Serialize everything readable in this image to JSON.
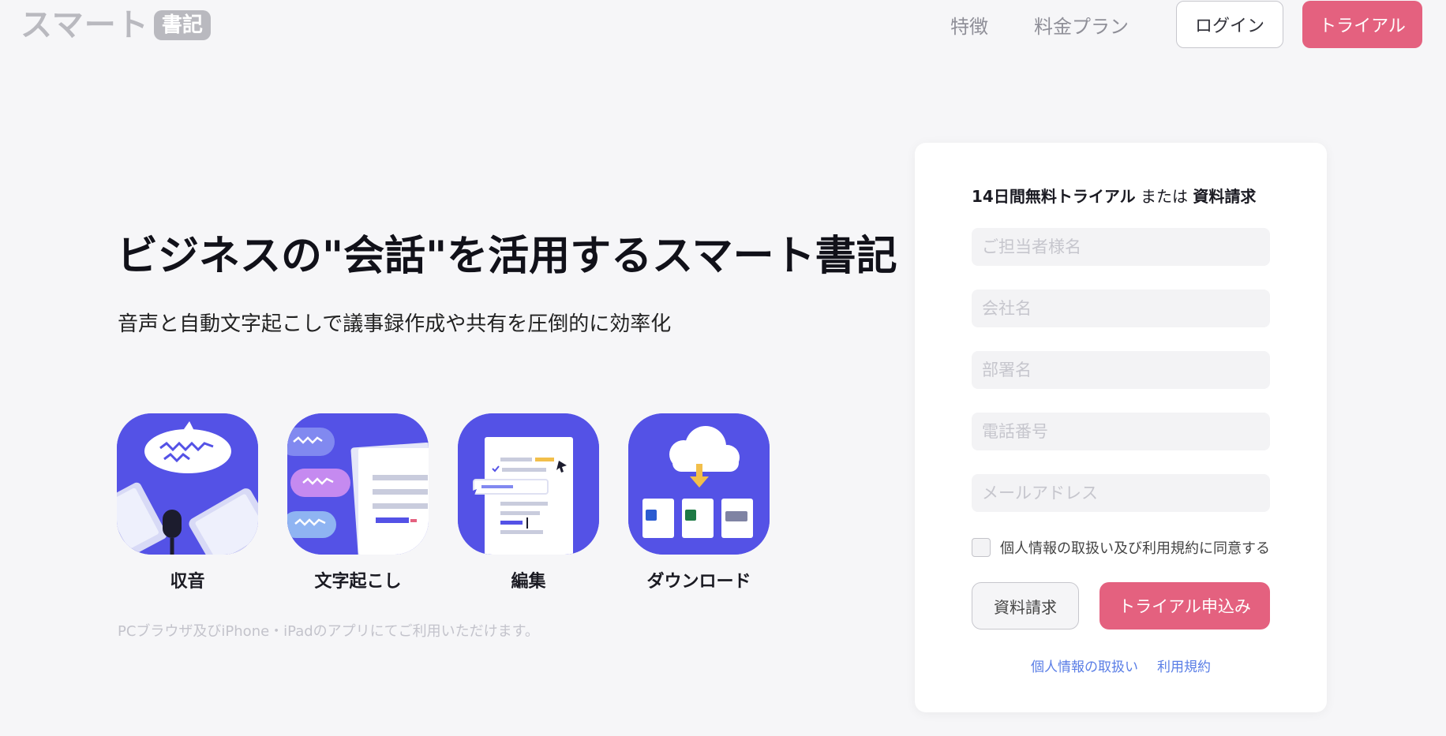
{
  "header": {
    "logo_text": "スマート",
    "logo_badge": "書記",
    "nav": [
      "特徴",
      "料金プラン"
    ],
    "login_label": "ログイン",
    "trial_label": "トライアル"
  },
  "hero": {
    "title": "ビジネスの\"会話\"を活用するスマート書記",
    "subtitle": "音声と自動文字起こしで議事録作成や共有を圧倒的に効率化"
  },
  "features": [
    {
      "label": "収音",
      "icon": "microphone-icon"
    },
    {
      "label": "文字起こし",
      "icon": "transcription-icon"
    },
    {
      "label": "編集",
      "icon": "edit-document-icon"
    },
    {
      "label": "ダウンロード",
      "icon": "cloud-download-icon"
    }
  ],
  "footnote": "PCブラウザ及びiPhone・iPadのアプリにてご利用いただけます。",
  "form": {
    "title_trial": "14日間無料トライアル",
    "title_or": " または ",
    "title_doc": "資料請求",
    "fields": {
      "name": {
        "placeholder": "ご担当者様名",
        "value": ""
      },
      "company": {
        "placeholder": "会社名",
        "value": ""
      },
      "department": {
        "placeholder": "部署名",
        "value": ""
      },
      "phone": {
        "placeholder": "電話番号",
        "value": ""
      },
      "email": {
        "placeholder": "メールアドレス",
        "value": ""
      }
    },
    "agree_label": "個人情報の取扱い及び利用規約に同意する",
    "doc_button": "資料請求",
    "apply_button": "トライアル申込み",
    "privacy_link": "個人情報の取扱い",
    "terms_link": "利用規約"
  },
  "colors": {
    "accent": "#e4617f",
    "icon_bg": "#5452e6",
    "link": "#5a7ee6"
  }
}
